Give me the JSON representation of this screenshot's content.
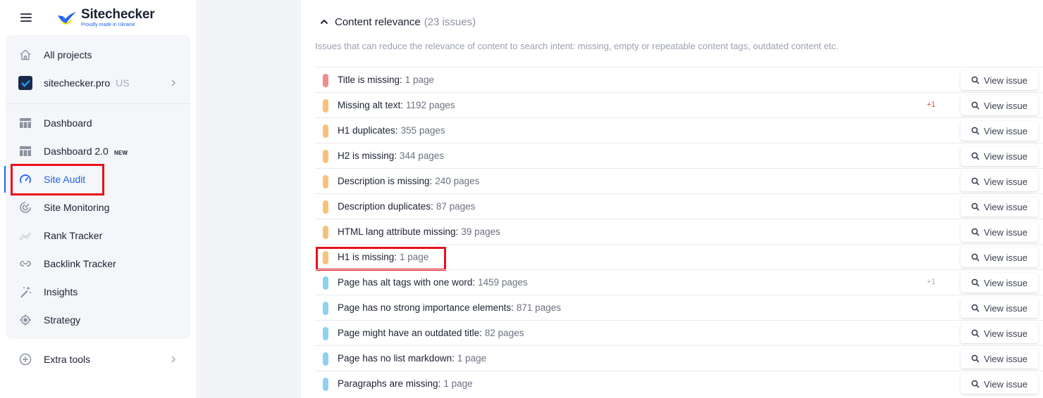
{
  "brand": {
    "name": "Sitechecker",
    "tagline": "Proudly made in Ukraine"
  },
  "sidebar": {
    "all_projects": "All projects",
    "project": {
      "name": "sitechecker.pro",
      "country": "US"
    },
    "items": [
      {
        "label": "Dashboard",
        "icon": "dashboard-icon"
      },
      {
        "label": "Dashboard 2.0",
        "badge": "NEW",
        "icon": "dashboard-icon"
      },
      {
        "label": "Site Audit",
        "icon": "gauge-icon",
        "active": true
      },
      {
        "label": "Site Monitoring",
        "icon": "radar-icon"
      },
      {
        "label": "Rank Tracker",
        "icon": "trend-icon"
      },
      {
        "label": "Backlink Tracker",
        "icon": "link-icon"
      },
      {
        "label": "Insights",
        "icon": "magic-wand-icon"
      },
      {
        "label": "Strategy",
        "icon": "target-icon"
      }
    ],
    "extra_tools": "Extra tools"
  },
  "section": {
    "title": "Content relevance",
    "count": "(23 issues)",
    "description": "Issues that can reduce the relevance of content to search intent: missing, empty or repeatable content tags, outdated content etc."
  },
  "view_label": "View issue",
  "colors": {
    "accent": "#1c64f2",
    "critical": "#f28b8b",
    "warning": "#f6c27a",
    "notice": "#8fd0f5",
    "highlight": "#e8121b",
    "plus_red": "#e8434b",
    "plus_grey": "#a7adba"
  },
  "issues": [
    {
      "name": "Title is missing:",
      "pages": "1 page",
      "severity": "critical"
    },
    {
      "name": "Missing alt text:",
      "pages": "1192 pages",
      "severity": "warning",
      "plus": "+1",
      "plus_color": "red"
    },
    {
      "name": "H1 duplicates:",
      "pages": "355 pages",
      "severity": "warning"
    },
    {
      "name": "H2 is missing:",
      "pages": "344 pages",
      "severity": "warning"
    },
    {
      "name": "Description is missing:",
      "pages": "240 pages",
      "severity": "warning"
    },
    {
      "name": "Description duplicates:",
      "pages": "87 pages",
      "severity": "warning"
    },
    {
      "name": "HTML lang attribute missing:",
      "pages": "39 pages",
      "severity": "warning"
    },
    {
      "name": "H1 is missing:",
      "pages": "1 page",
      "severity": "warning",
      "highlighted": true
    },
    {
      "name": "Page has alt tags with one word:",
      "pages": "1459 pages",
      "severity": "notice",
      "plus": "+1",
      "plus_color": "grey"
    },
    {
      "name": "Page has no strong importance elements:",
      "pages": "871 pages",
      "severity": "notice"
    },
    {
      "name": "Page might have an outdated title:",
      "pages": "82 pages",
      "severity": "notice"
    },
    {
      "name": "Page has no list markdown:",
      "pages": "1 page",
      "severity": "notice"
    },
    {
      "name": "Paragraphs are missing:",
      "pages": "1 page",
      "severity": "notice"
    }
  ]
}
